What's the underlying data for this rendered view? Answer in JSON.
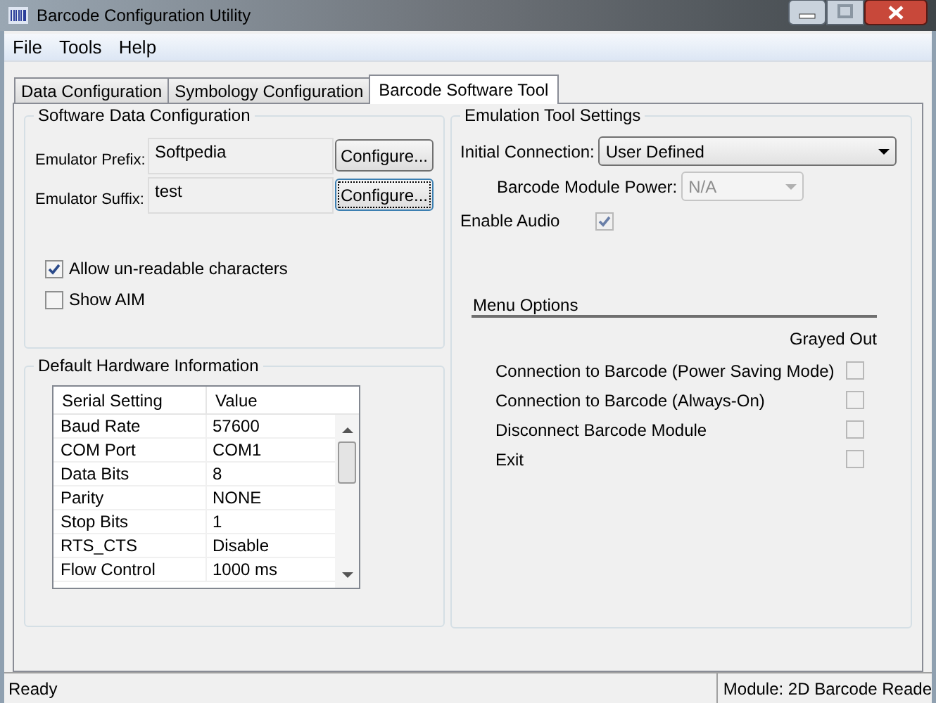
{
  "window": {
    "title": "Barcode Configuration Utility"
  },
  "menu": [
    "File",
    "Tools",
    "Help"
  ],
  "tabs": [
    {
      "label": "Data Configuration",
      "selected": false
    },
    {
      "label": "Symbology Configuration",
      "selected": false
    },
    {
      "label": "Barcode Software Tool",
      "selected": true
    }
  ],
  "software_data": {
    "title": "Software Data Configuration",
    "fields": [
      {
        "label": "Emulator Prefix:",
        "value": "Softpedia",
        "button": "Configure...",
        "focused": false
      },
      {
        "label": "Emulator Suffix:",
        "value": "test",
        "button": "Configure...",
        "focused": true
      }
    ],
    "checkboxes": [
      {
        "label": "Allow un-readable characters",
        "checked": true
      },
      {
        "label": "Show AIM",
        "checked": false
      }
    ]
  },
  "hardware": {
    "title": "Default Hardware Information",
    "columns": [
      "Serial Setting",
      "Value"
    ],
    "rows": [
      [
        "Baud Rate",
        "57600"
      ],
      [
        "COM Port",
        "COM1"
      ],
      [
        "Data Bits",
        "8"
      ],
      [
        "Parity",
        "NONE"
      ],
      [
        "Stop Bits",
        "1"
      ],
      [
        "RTS_CTS",
        "Disable"
      ],
      [
        "Flow Control",
        "1000 ms"
      ]
    ]
  },
  "emulation": {
    "title": "Emulation Tool Settings",
    "initial_connection": {
      "label": "Initial Connection:",
      "value": "User Defined",
      "disabled": false
    },
    "module_power": {
      "label": "Barcode Module Power:",
      "value": "N/A",
      "disabled": true
    },
    "enable_audio": {
      "label": "Enable Audio",
      "checked": true
    },
    "menu_options": {
      "title": "Menu Options",
      "column_label": "Grayed Out",
      "items": [
        {
          "label": "Connection to Barcode (Power Saving Mode)",
          "checked": false
        },
        {
          "label": "Connection to Barcode (Always-On)",
          "checked": false
        },
        {
          "label": "Disconnect Barcode Module",
          "checked": false
        },
        {
          "label": "Exit",
          "checked": false
        }
      ]
    }
  },
  "status_bar": [
    "Ready",
    "Module: 2D Barcode Reade"
  ]
}
